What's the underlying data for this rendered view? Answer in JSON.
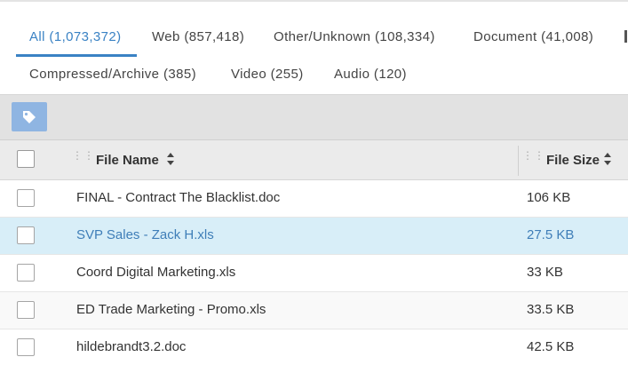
{
  "tabs": [
    {
      "label": "All (1,073,372)"
    },
    {
      "label": "Web (857,418)"
    },
    {
      "label": "Other/Unknown (108,334)"
    },
    {
      "label": "Document (41,008)"
    },
    {
      "label": "Compressed/Archive (385)"
    },
    {
      "label": "Video (255)"
    },
    {
      "label": "Audio (120)"
    }
  ],
  "active_tab": "All (1,073,372)",
  "toolbar": {
    "tag_icon": "tag-icon"
  },
  "table": {
    "columns": [
      {
        "label": "File Name",
        "sort_icon": "sort-icon"
      },
      {
        "label": "File Size",
        "sort_icon": "sort-icon"
      }
    ],
    "rows": [
      {
        "name": "FINAL - Contract The Blacklist.doc",
        "size": "106 KB",
        "selected": false
      },
      {
        "name": "SVP Sales - Zack H.xls",
        "size": "27.5 KB",
        "selected": true
      },
      {
        "name": "Coord Digital Marketing.xls",
        "size": "33 KB",
        "selected": false
      },
      {
        "name": "ED Trade Marketing - Promo.xls",
        "size": "33.5 KB",
        "selected": false
      },
      {
        "name": "hildebrandt3.2.doc",
        "size": "42.5 KB",
        "selected": false
      }
    ]
  },
  "colors": {
    "accent": "#3a82c4",
    "selected_row": "#d8eef8",
    "tag_button": "#8fb5e2"
  }
}
